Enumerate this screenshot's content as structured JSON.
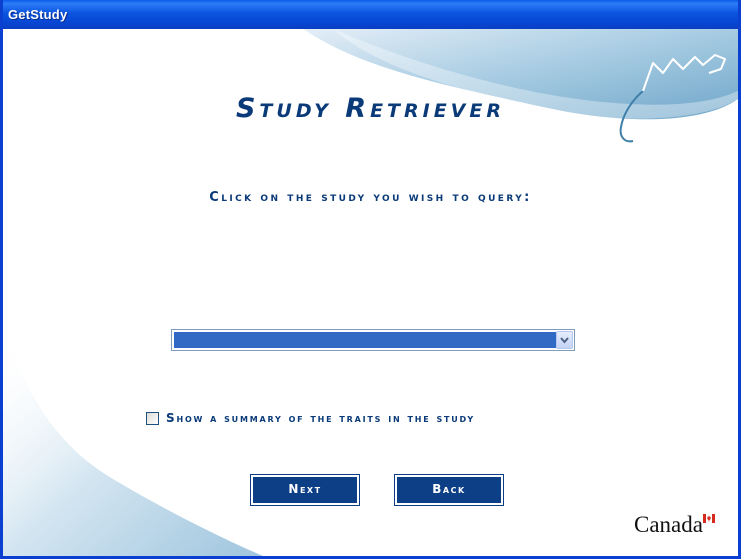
{
  "window": {
    "title": "GetStudy"
  },
  "main": {
    "heading": "Study Retriever",
    "instruction": "Click on the study you wish to query:",
    "study_select": {
      "selected": ""
    },
    "summary_checkbox": {
      "label": "Show a summary of the traits in the study",
      "checked": false
    }
  },
  "buttons": {
    "next": "Next",
    "back": "Back"
  },
  "branding": {
    "wordmark": "Canada"
  },
  "colors": {
    "titlebar": "#0a5ae8",
    "heading": "#0a3a78",
    "button_bg": "#0c3f86",
    "selection": "#316ac5"
  }
}
